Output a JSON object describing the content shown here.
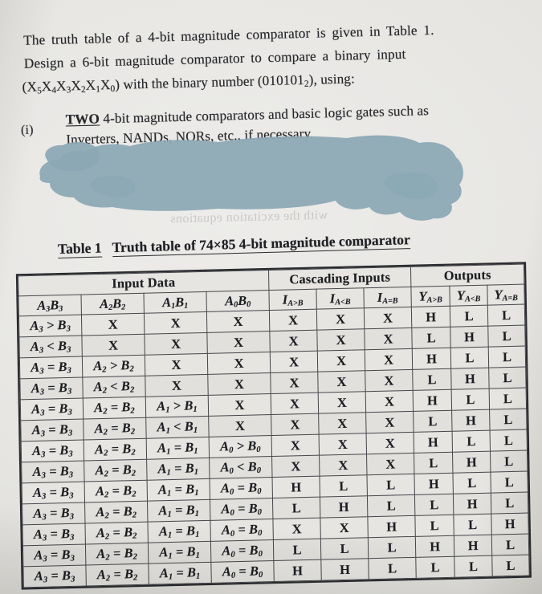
{
  "document": {
    "paper_color": "#e9e8e5",
    "ink_color": "#25262a"
  },
  "prose": {
    "line1": "The truth table of a 4-bit magnitude comparator is given in Table 1.",
    "line2": "Design a 6-bit magnitude comparator to compare a binary input",
    "line3_a": "(X",
    "line3_subs": [
      "5",
      "4",
      "3",
      "2",
      "1",
      "0"
    ],
    "line3_vars": [
      "X",
      "X",
      "X",
      "X",
      "X"
    ],
    "line3_b": ") with the binary number (010101",
    "line3_sub2": "2",
    "line3_c": "), using:",
    "item_i_label": "(i)",
    "item_i_bold": "TWO",
    "item_i_rest": " 4-bit magnitude comparators and basic logic gates such as",
    "item_i_line2": "Inverters, NANDs, NORs, etc., if necessary."
  },
  "redaction": {
    "label": "blue highlighter redaction blob",
    "color": "#8ca8b5"
  },
  "ghost_text": {
    "line1": "with the excitation equations"
  },
  "caption": {
    "table_label": "Table 1",
    "title": "Truth table of 74×85 4-bit magnitude comparator"
  },
  "chart_data": {
    "type": "table",
    "title": "Truth table of 74×85 4-bit magnitude comparator",
    "group_headers": [
      {
        "label": "Input Data",
        "span": 4
      },
      {
        "label": "Cascading Inputs",
        "span": 3
      },
      {
        "label": "Outputs",
        "span": 3
      }
    ],
    "columns": [
      {
        "base": "A",
        "sub": "3",
        "base2": "B",
        "sub2": "3"
      },
      {
        "base": "A",
        "sub": "2",
        "base2": "B",
        "sub2": "2"
      },
      {
        "base": "A",
        "sub": "1",
        "base2": "B",
        "sub2": "1"
      },
      {
        "base": "A",
        "sub": "0",
        "base2": "B",
        "sub2": "0"
      },
      {
        "base": "I",
        "sub": "A>B"
      },
      {
        "base": "I",
        "sub": "A<B"
      },
      {
        "base": "I",
        "sub": "A=B"
      },
      {
        "base": "Y",
        "sub": "A>B"
      },
      {
        "base": "Y",
        "sub": "A<B"
      },
      {
        "base": "Y",
        "sub": "A=B"
      }
    ],
    "rows": [
      [
        "A₃ > B₃",
        "X",
        "X",
        "X",
        "X",
        "X",
        "X",
        "H",
        "L",
        "L"
      ],
      [
        "A₃ < B₃",
        "X",
        "X",
        "X",
        "X",
        "X",
        "X",
        "L",
        "H",
        "L"
      ],
      [
        "A₃ = B₃",
        "A₂ > B₂",
        "X",
        "X",
        "X",
        "X",
        "X",
        "H",
        "L",
        "L"
      ],
      [
        "A₃ = B₃",
        "A₂ < B₂",
        "X",
        "X",
        "X",
        "X",
        "X",
        "L",
        "H",
        "L"
      ],
      [
        "A₃ = B₃",
        "A₂ = B₂",
        "A₁ > B₁",
        "X",
        "X",
        "X",
        "X",
        "H",
        "L",
        "L"
      ],
      [
        "A₃ = B₃",
        "A₂ = B₂",
        "A₁ < B₁",
        "X",
        "X",
        "X",
        "X",
        "L",
        "H",
        "L"
      ],
      [
        "A₃ = B₃",
        "A₂ = B₂",
        "A₁ = B₁",
        "A₀ > B₀",
        "X",
        "X",
        "X",
        "H",
        "L",
        "L"
      ],
      [
        "A₃ = B₃",
        "A₂ = B₂",
        "A₁ = B₁",
        "A₀ < B₀",
        "X",
        "X",
        "X",
        "L",
        "H",
        "L"
      ],
      [
        "A₃ = B₃",
        "A₂ = B₂",
        "A₁ = B₁",
        "A₀ = B₀",
        "H",
        "L",
        "L",
        "H",
        "L",
        "L"
      ],
      [
        "A₃ = B₃",
        "A₂ = B₂",
        "A₁ = B₁",
        "A₀ = B₀",
        "L",
        "H",
        "L",
        "L",
        "H",
        "L"
      ],
      [
        "A₃ = B₃",
        "A₂ = B₂",
        "A₁ = B₁",
        "A₀ = B₀",
        "X",
        "X",
        "H",
        "L",
        "L",
        "H"
      ],
      [
        "A₃ = B₃",
        "A₂ = B₂",
        "A₁ = B₁",
        "A₀ = B₀",
        "L",
        "L",
        "L",
        "H",
        "H",
        "L"
      ],
      [
        "A₃ = B₃",
        "A₂ = B₂",
        "A₁ = B₁",
        "A₀ = B₀",
        "H",
        "H",
        "L",
        "L",
        "L",
        "L"
      ]
    ],
    "row_count": 13,
    "col_count": 10
  }
}
